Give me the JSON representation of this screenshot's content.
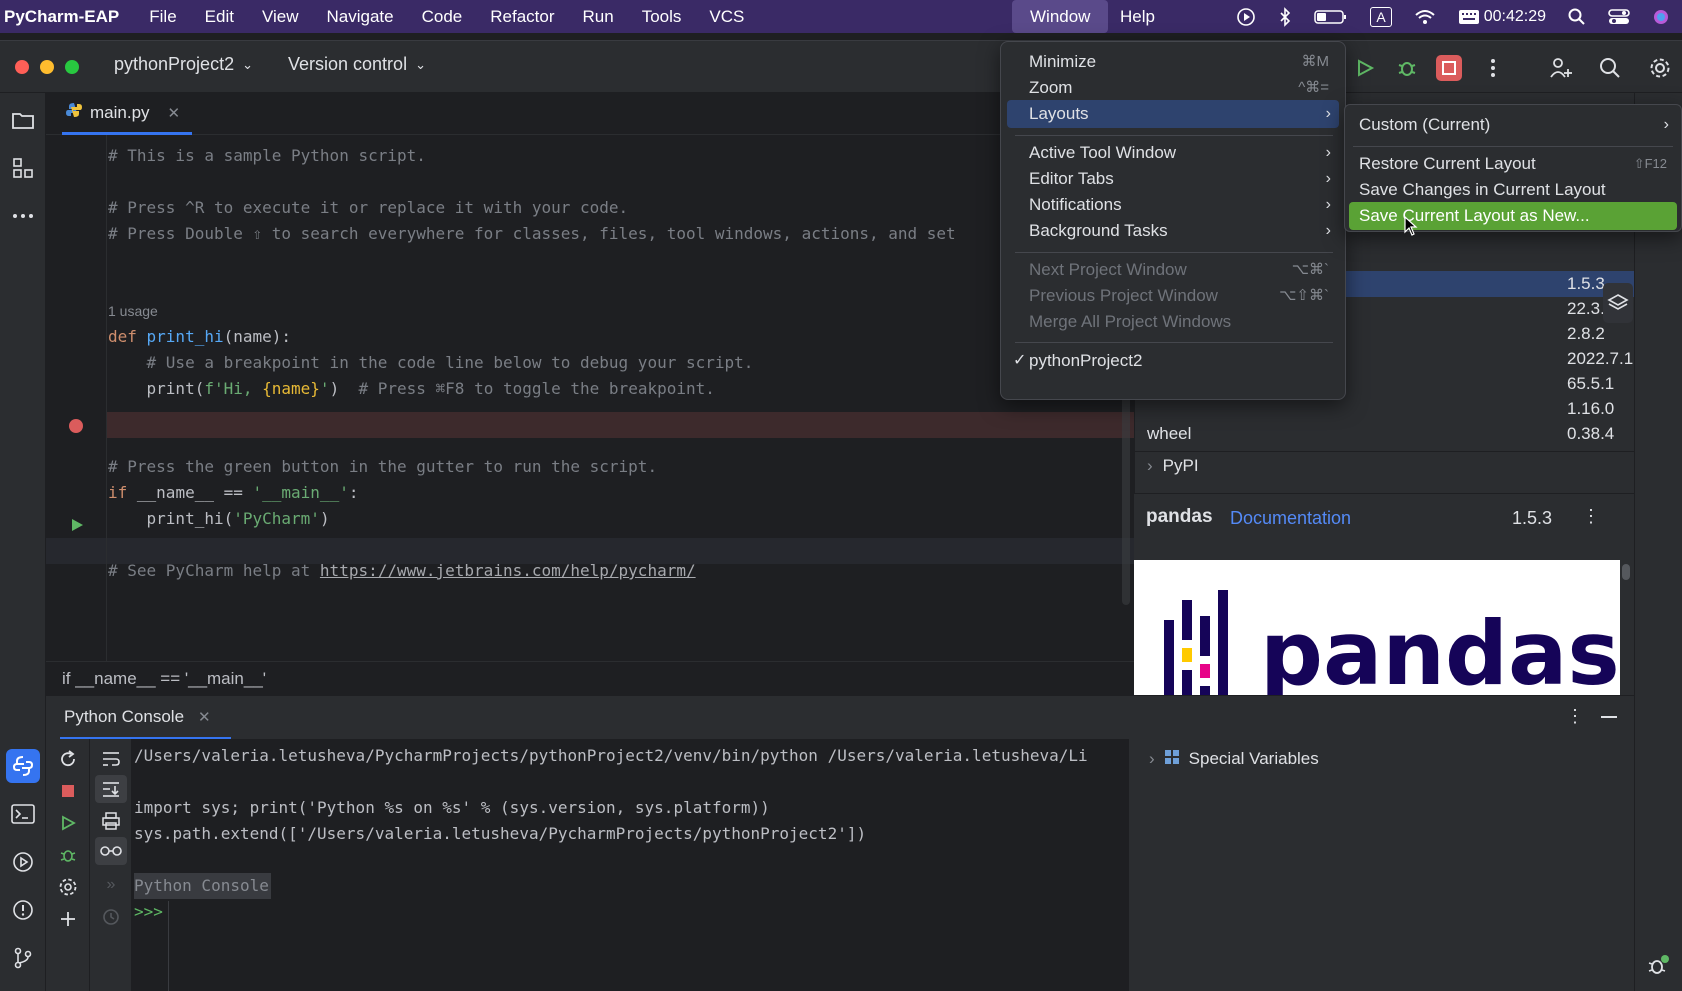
{
  "menubar": {
    "app": "PyCharm-EAP",
    "items": [
      "File",
      "Edit",
      "View",
      "Navigate",
      "Code",
      "Refactor",
      "Run",
      "Tools",
      "VCS"
    ],
    "window": "Window",
    "help": "Help",
    "input_source": "A",
    "clock": "00:42:29"
  },
  "titlebar": {
    "project": "pythonProject2",
    "vcs": "Version control"
  },
  "editor": {
    "tab": "main.py",
    "usage_hint": "1 usage",
    "breadcrumb": "if __name__ == '__main__'"
  },
  "code": {
    "l1": "# This is a sample Python script.",
    "l3": "# Press ^R to execute it or replace it with your code.",
    "l4": "# Press Double ⇧ to search everywhere for classes, files, tool windows, actions, and set",
    "def_kw": "def ",
    "def_name": "print_hi",
    "def_rest": "(name):",
    "bp_comment": "    # Use a breakpoint in the code line below to debug your script.",
    "print_fn": "    print(",
    "print_str1": "f'Hi, ",
    "print_brace": "{name}",
    "print_str2": "'",
    "print_close": ")  ",
    "print_comment": "# Press ⌘F8 to toggle the breakpoint.",
    "run_comment": "# Press the green button in the gutter to run the script.",
    "if_kw": "if ",
    "if_mid": "__name__ == ",
    "if_str": "'__main__'",
    "if_end": ":",
    "call_fn": "    print_hi(",
    "call_str": "'PyCharm'",
    "call_end": ")",
    "help_prefix": "# See PyCharm help at ",
    "help_link": "https://www.jetbrains.com/help/pycharm/"
  },
  "packages": {
    "versions": [
      "1.5.3",
      "22.3.1",
      "2.8.2",
      "2022.7.1",
      "65.5.1",
      "1.16.0"
    ],
    "wheel": {
      "name": "wheel",
      "version": "0.38.4"
    },
    "pypi": "PyPI",
    "detail": {
      "name": "pandas",
      "doc": "Documentation",
      "version": "1.5.3",
      "logo_text": "pandas"
    }
  },
  "console": {
    "tab": "Python Console",
    "lines": [
      "/Users/valeria.letusheva/PycharmProjects/pythonProject2/venv/bin/python /Users/valeria.letusheva/Li",
      "import sys; print('Python %s on %s' % (sys.version, sys.platform))",
      "sys.path.extend(['/Users/valeria.letusheva/PycharmProjects/pythonProject2'])"
    ],
    "banner": "Python Console",
    "prompt": ">>>",
    "special_vars": "Special Variables"
  },
  "window_menu": {
    "minimize": {
      "label": "Minimize",
      "shortcut": "⌘M"
    },
    "zoom": {
      "label": "Zoom",
      "shortcut": "^⌘="
    },
    "layouts": "Layouts",
    "active_tool_window": "Active Tool Window",
    "editor_tabs": "Editor Tabs",
    "notifications": "Notifications",
    "background_tasks": "Background Tasks",
    "next_project": {
      "label": "Next Project Window",
      "shortcut": "⌥⌘`"
    },
    "previous_project": {
      "label": "Previous Project Window",
      "shortcut": "⌥⇧⌘`"
    },
    "merge_all": "Merge All Project Windows",
    "project": "pythonProject2"
  },
  "layouts_menu": {
    "custom": "Custom (Current)",
    "restore": {
      "label": "Restore Current Layout",
      "shortcut": "⇧F12"
    },
    "save_changes": "Save Changes in Current Layout",
    "save_new": "Save Current Layout as New..."
  },
  "colors": {
    "accent": "#3574f0",
    "selection_green": "#5aa235",
    "menubar": "#3a2a66"
  }
}
